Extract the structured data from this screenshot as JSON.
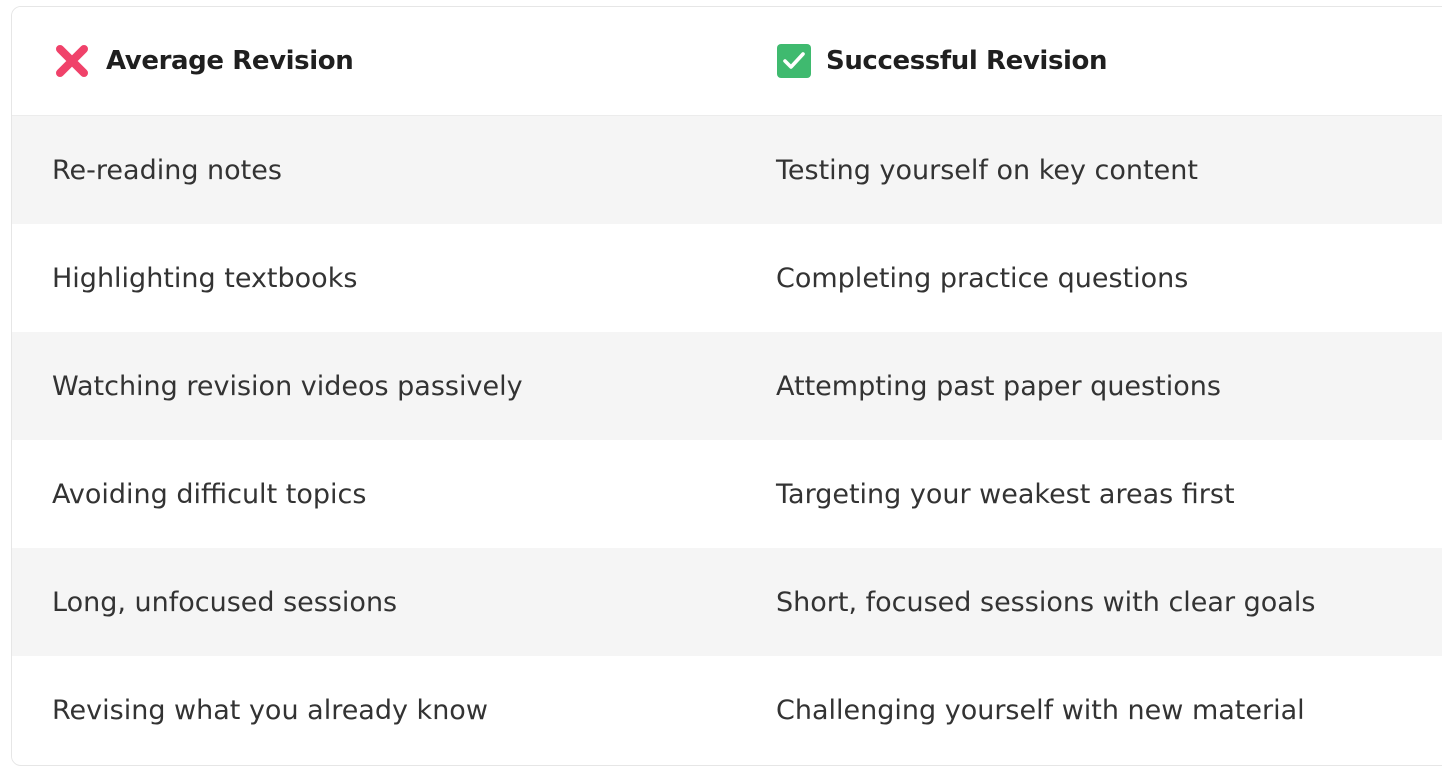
{
  "table": {
    "headers": {
      "left": {
        "label": "Average Revision",
        "icon": "cross-mark-icon",
        "icon_color": "#f0426a"
      },
      "right": {
        "label": "Successful Revision",
        "icon": "check-box-icon",
        "icon_color": "#3fba6f"
      }
    },
    "rows": [
      {
        "average": "Re-reading notes",
        "successful": "Testing yourself on key content"
      },
      {
        "average": "Highlighting textbooks",
        "successful": "Completing practice questions"
      },
      {
        "average": "Watching revision videos passively",
        "successful": "Attempting past paper questions"
      },
      {
        "average": "Avoiding difficult topics",
        "successful": "Targeting your weakest areas first"
      },
      {
        "average": "Long, unfocused sessions",
        "successful": "Short, focused sessions with clear goals"
      },
      {
        "average": "Revising what you already know",
        "successful": "Challenging yourself with new material"
      }
    ]
  }
}
